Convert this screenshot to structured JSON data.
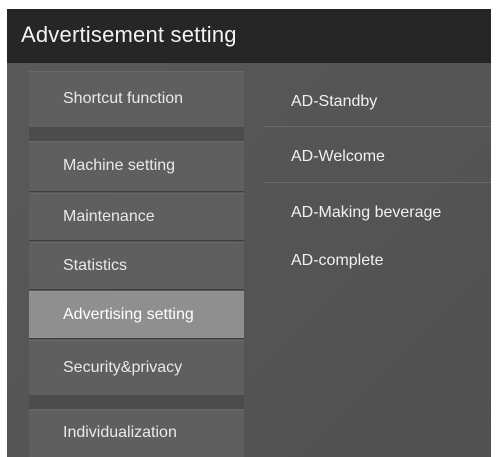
{
  "header": {
    "title": "Advertisement setting"
  },
  "sidebar": {
    "items": [
      {
        "label": "Shortcut function"
      },
      {
        "label": "Machine setting"
      },
      {
        "label": "Maintenance"
      },
      {
        "label": "Statistics"
      },
      {
        "label": "Advertising setting",
        "selected": true
      },
      {
        "label": "Security&privacy"
      },
      {
        "label": "Individualization"
      }
    ]
  },
  "main": {
    "items": [
      {
        "label": "AD-Standby"
      },
      {
        "label": "AD-Welcome"
      },
      {
        "label": "AD-Making beverage"
      },
      {
        "label": "AD-complete"
      }
    ]
  },
  "colors": {
    "topbar": "#262626",
    "background": "#565656",
    "sidebar_item": "#5f5f5f",
    "sidebar_selected": "#8f8f8f",
    "text": "#f0f0f0"
  }
}
